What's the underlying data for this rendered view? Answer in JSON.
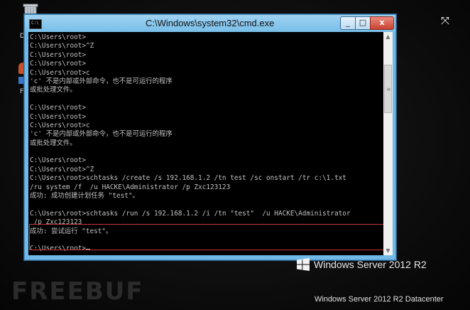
{
  "window": {
    "title": "C:\\Windows\\system32\\cmd.exe",
    "icon_label": "C:\\",
    "minimize_label": "_",
    "maximize_label": "□",
    "close_label": "x"
  },
  "console": {
    "lines": [
      "C:\\Users\\root>",
      "C:\\Users\\root>^Z",
      "C:\\Users\\root>",
      "C:\\Users\\root>",
      "C:\\Users\\root>c",
      "'c' 不是内部或外部命令，也不是可运行的程序",
      "或批处理文件。",
      "",
      "C:\\Users\\root>",
      "C:\\Users\\root>",
      "C:\\Users\\root>c",
      "'c' 不是内部或外部命令，也不是可运行的程序",
      "或批处理文件。",
      "",
      "C:\\Users\\root>",
      "C:\\Users\\root>^Z",
      "C:\\Users\\root>schtasks /create /s 192.168.1.2 /tn test /sc onstart /tr c:\\1.txt",
      "/ru system /f  /u HACKE\\Administrator /p Zxc123123",
      "成功: 成功创建计划任务 \"test\"。",
      "",
      "C:\\Users\\root>schtasks /run /s 192.168.1.2 /i /tn \"test\"  /u HACKE\\Administrator",
      " /p Zxc123123",
      "成功: 尝试运行 \"test\"。",
      "",
      "C:\\Users\\root>"
    ]
  },
  "scrollbar": {
    "up_arrow": "▲",
    "down_arrow": "▼",
    "grip": "≡"
  },
  "fullscreen_icon": "⤧",
  "branding": {
    "product": "Windows Server 2012 R2",
    "edition": "Windows Server 2012 R2 Datacenter",
    "watermark": "FREEBUF"
  },
  "colors": {
    "console_bg": "#000000",
    "console_text": "#c0c0c0",
    "titlebar": "#78bfe9",
    "close_button": "#c84332",
    "highlight_border": "#c83737"
  }
}
